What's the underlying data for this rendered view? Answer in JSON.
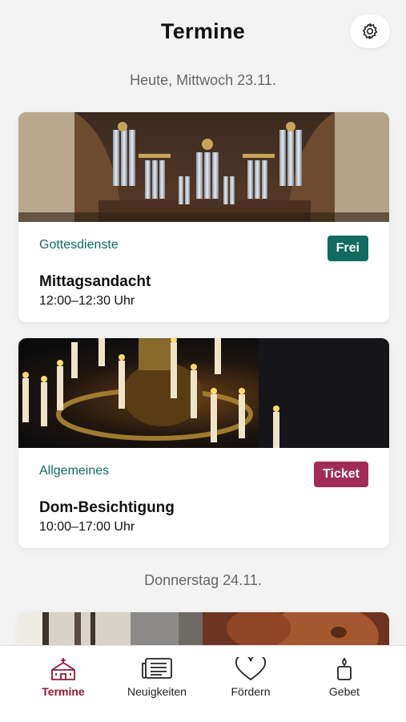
{
  "header": {
    "title": "Termine"
  },
  "settings_icon": "gear-icon",
  "sections": [
    {
      "date": "Heute, Mittwoch 23.11."
    },
    {
      "date": "Donnerstag 24.11."
    }
  ],
  "events": [
    {
      "category": "Gottesdienste",
      "badge": "Frei",
      "badge_color": "#0f6c5f",
      "title": "Mittagsandacht",
      "time": "12:00–12:30 Uhr",
      "image": "organ-photo"
    },
    {
      "category": "Allgemeines",
      "badge": "Ticket",
      "badge_color": "#a22c58",
      "title": "Dom-Besichtigung",
      "time": "10:00–17:00 Uhr",
      "image": "chandelier-photo"
    },
    {
      "image": "sculpture-photo"
    }
  ],
  "tabs": [
    {
      "label": "Termine",
      "icon": "church-icon",
      "active": true
    },
    {
      "label": "Neuigkeiten",
      "icon": "newspaper-icon",
      "active": false
    },
    {
      "label": "Fördern",
      "icon": "heart-icon",
      "active": false
    },
    {
      "label": "Gebet",
      "icon": "candle-icon",
      "active": false
    }
  ],
  "colors": {
    "accent": "#8f1a36",
    "category": "#0e6b5f",
    "background": "#f3f3f3"
  }
}
